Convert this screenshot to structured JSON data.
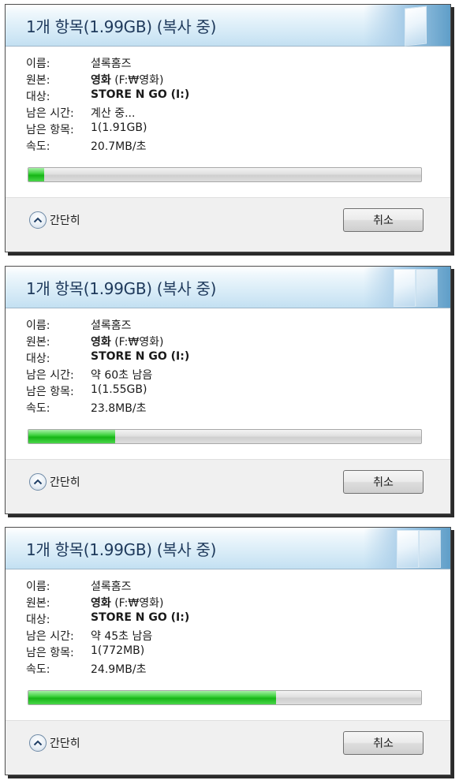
{
  "dialogs": [
    {
      "title": "1개 항목(1.99GB) (복사 중)",
      "name_label": "이름:",
      "name_value": "셜록홈즈",
      "source_label": "원본:",
      "source_name": "영화",
      "source_path": "(F:₩영화)",
      "dest_label": "대상:",
      "dest_value": "STORE N GO (I:)",
      "time_label": "남은 시간:",
      "time_value": "계산 중...",
      "items_label": "남은 항목:",
      "items_value": "1(1.91GB)",
      "speed_label": "속도:",
      "speed_value": "20.7MB/초",
      "progress": 0.04,
      "collapse_label": "간단히",
      "cancel_label": "취소"
    },
    {
      "title": "1개 항목(1.99GB) (복사 중)",
      "name_label": "이름:",
      "name_value": "셜록홈즈",
      "source_label": "원본:",
      "source_name": "영화",
      "source_path": "(F:₩영화)",
      "dest_label": "대상:",
      "dest_value": "STORE N GO (I:)",
      "time_label": "남은 시간:",
      "time_value": "약 60초 남음",
      "items_label": "남은 항목:",
      "items_value": "1(1.55GB)",
      "speed_label": "속도:",
      "speed_value": "23.8MB/초",
      "progress": 0.22,
      "collapse_label": "간단히",
      "cancel_label": "취소"
    },
    {
      "title": "1개 항목(1.99GB) (복사 중)",
      "name_label": "이름:",
      "name_value": "셜록홈즈",
      "source_label": "원본:",
      "source_name": "영화",
      "source_path": "(F:₩영화)",
      "dest_label": "대상:",
      "dest_value": "STORE N GO (I:)",
      "time_label": "남은 시간:",
      "time_value": "약 45초 남음",
      "items_label": "남은 항목:",
      "items_value": "1(772MB)",
      "speed_label": "속도:",
      "speed_value": "24.9MB/초",
      "progress": 0.63,
      "collapse_label": "간단히",
      "cancel_label": "취소"
    }
  ],
  "colors": {
    "title_text": "#1e395b",
    "progress_fill": "#17b517",
    "footer_bg": "#f0f0f0"
  },
  "icons": {
    "collapse": "chevron-up-icon",
    "header": "window-pane-icon"
  }
}
